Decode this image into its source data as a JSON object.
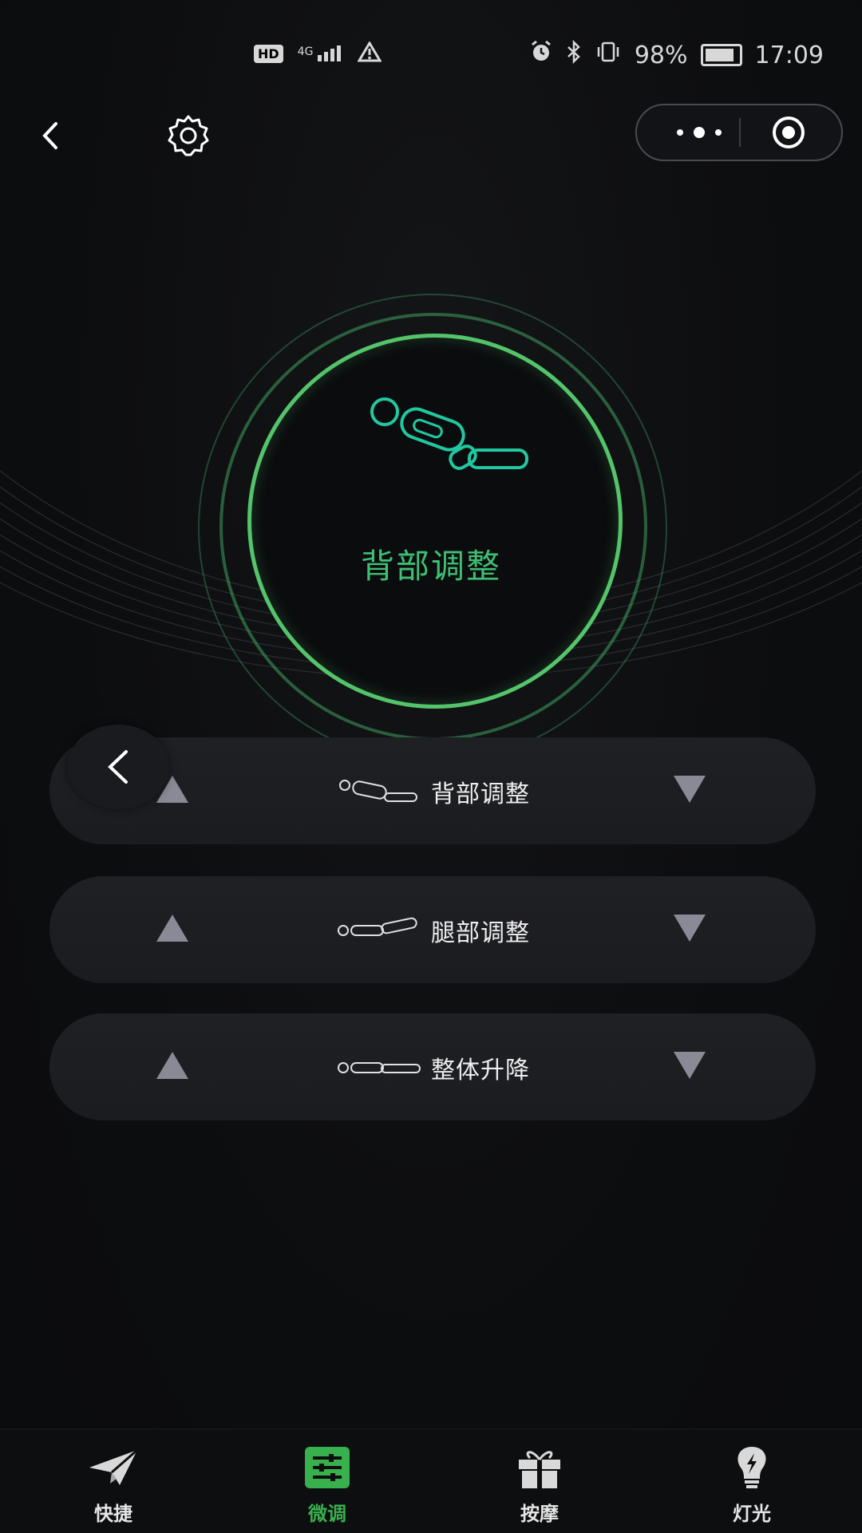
{
  "status_bar": {
    "hd": "HD",
    "network": "4G",
    "battery_percent": "98%",
    "battery_level": 0.98,
    "time": "17:09"
  },
  "hero": {
    "title": "背部调整",
    "accent_color": "#54c46a",
    "text_color": "#3fbf74"
  },
  "controls": [
    {
      "label": "背部调整",
      "icon": "back-adjust-icon"
    },
    {
      "label": "腿部调整",
      "icon": "leg-adjust-icon"
    },
    {
      "label": "整体升降",
      "icon": "lift-icon"
    }
  ],
  "tabs": [
    {
      "label": "快捷",
      "icon": "paper-plane-icon",
      "active": false
    },
    {
      "label": "微调",
      "icon": "sliders-icon",
      "active": true
    },
    {
      "label": "按摩",
      "icon": "gift-icon",
      "active": false
    },
    {
      "label": "灯光",
      "icon": "bulb-icon",
      "active": false
    }
  ],
  "colors": {
    "background": "#0f1012",
    "active_tab": "#39b04e",
    "row_bg": "#1f2024",
    "arrow": "#8a8a96"
  }
}
